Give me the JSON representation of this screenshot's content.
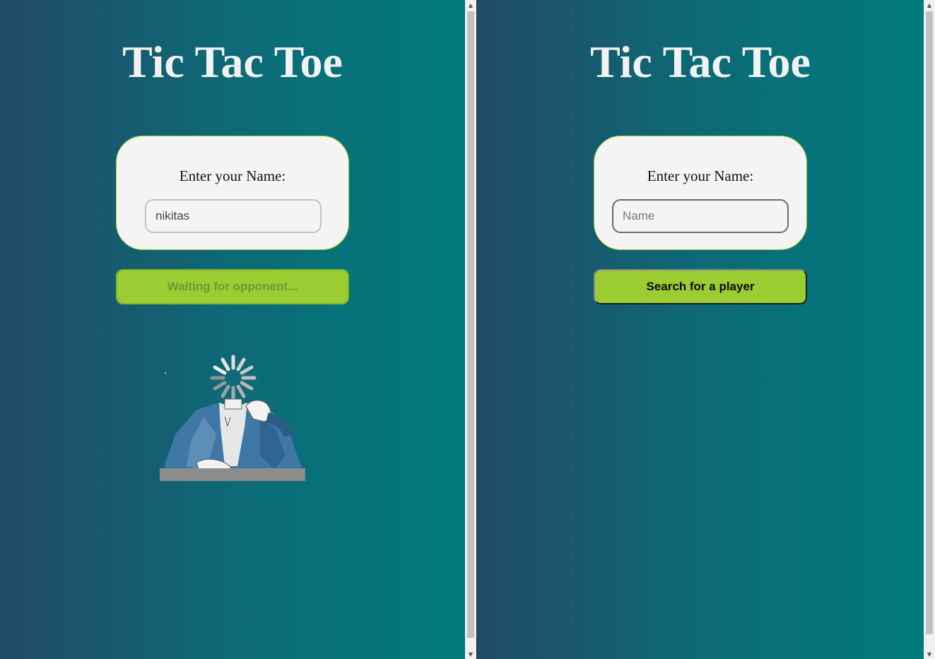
{
  "left": {
    "title": "Tic Tac Toe",
    "name_label": "Enter your Name:",
    "name_value": "nikitas",
    "button_label": "Waiting for opponent..."
  },
  "right": {
    "title": "Tic Tac Toe",
    "name_label": "Enter your Name:",
    "name_placeholder": "Name",
    "button_label": "Search for a player"
  },
  "colors": {
    "accent": "#9acd32",
    "background_start": "#224a68",
    "background_end": "#007b7d",
    "card": "#f4f4f4"
  },
  "icons": {
    "loading": "spinner-icon",
    "waiting": "waiting-person-illustration"
  }
}
